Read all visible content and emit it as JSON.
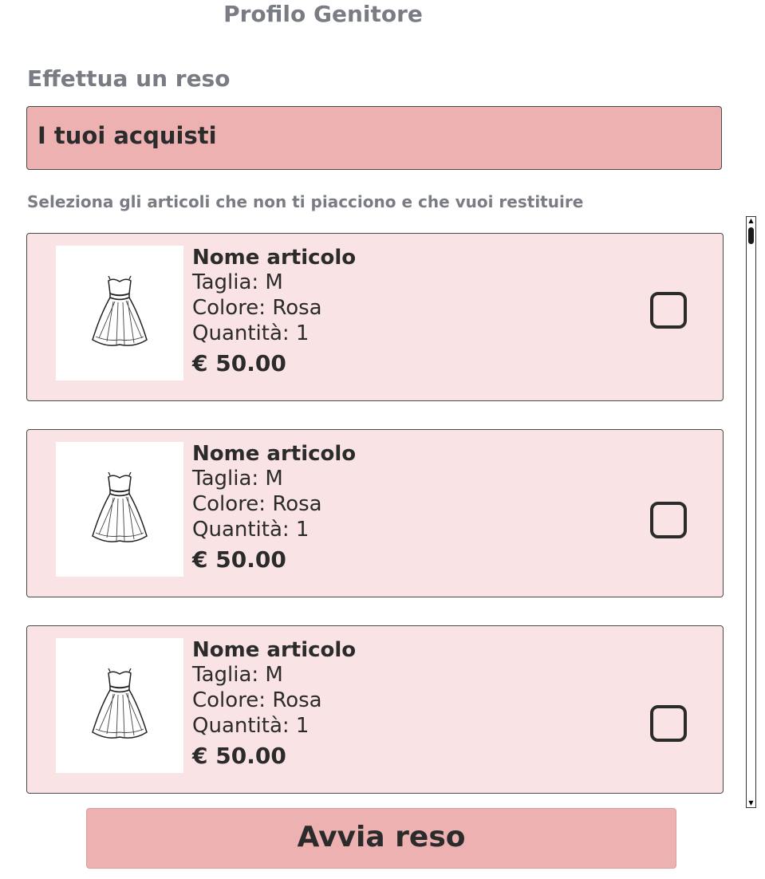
{
  "page": {
    "title": "Profilo Genitore"
  },
  "section": {
    "title": "Effettua un reso"
  },
  "purchases": {
    "header": "I tuoi acquisti",
    "instructions": "Seleziona gli articoli che non ti piacciono e che vuoi restituire",
    "items": [
      {
        "name": "Nome articolo",
        "size": "Taglia: M",
        "color": "Colore: Rosa",
        "quantity": "Quantità: 1",
        "price": "€ 50.00",
        "image_icon": "dress-icon",
        "checked": false
      },
      {
        "name": "Nome articolo",
        "size": "Taglia: M",
        "color": "Colore: Rosa",
        "quantity": "Quantità: 1",
        "price": "€ 50.00",
        "image_icon": "dress-icon",
        "checked": false
      },
      {
        "name": "Nome articolo",
        "size": "Taglia: M",
        "color": "Colore: Rosa",
        "quantity": "Quantità: 1",
        "price": "€ 50.00",
        "image_icon": "dress-icon",
        "checked": false
      }
    ]
  },
  "actions": {
    "start_return_label": "Avvia reso"
  },
  "colors": {
    "accent": "#edb1b1",
    "card_background": "#f9e3e4",
    "muted_text": "#7a7c84",
    "text": "#2b2b2b"
  }
}
